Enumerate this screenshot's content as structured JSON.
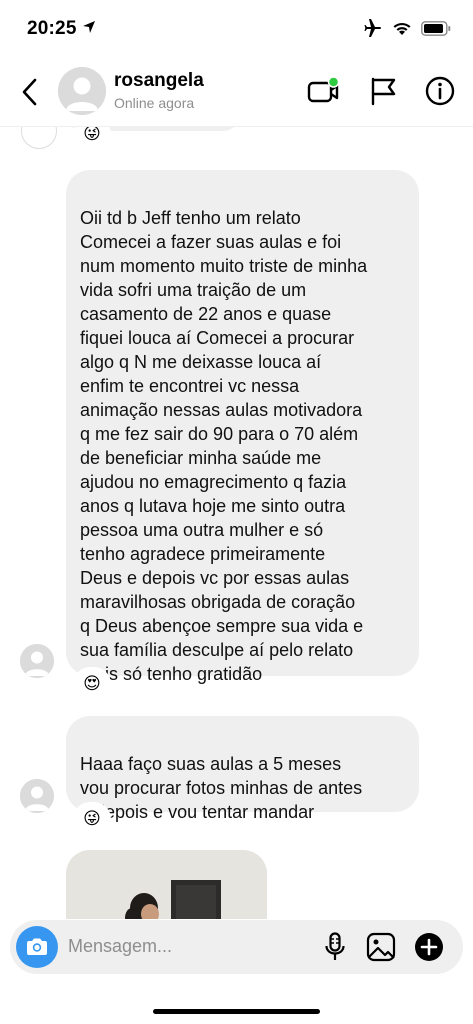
{
  "status_bar": {
    "time": "20:25"
  },
  "header": {
    "name": "rosangela",
    "status": "Online agora"
  },
  "messages": [
    {
      "text": "Oii td b Jeff  tenho um relato\nComecei a fazer suas aulas e foi\nnum momento muito triste de minha\nvida sofri uma traição  de um\ncasamento  de 22 anos e quase\nfiquei louca aí Comecei a procurar\nalgo q N me deixasse  louca aí\nenfim te encontrei  vc nessa\nanimação  nessas aulas motivadora\nq me fez sair do 90 para o 70 além\nde beneficiar  minha saúde me\najudou no emagrecimento  q fazia\nanos q lutava hoje me sinto outra\npessoa uma outra mulher e só\ntenho agradece  primeiramente\nDeus e depois vc por essas aulas\nmaravilhosas  obrigada  de coração\nq Deus abençoe  sempre  sua vida e\nsua família  desculpe  aí pelo relato\nmais só  tenho gratidão",
      "reaction": "😍"
    },
    {
      "text": "Haaa  faço suas aulas a  5 meses\nvou procurar  fotos minhas de antes\ne depois e vou tentar mandar",
      "reaction": "😜"
    }
  ],
  "top_reaction": "😜",
  "composer": {
    "placeholder": "Mensagem..."
  }
}
